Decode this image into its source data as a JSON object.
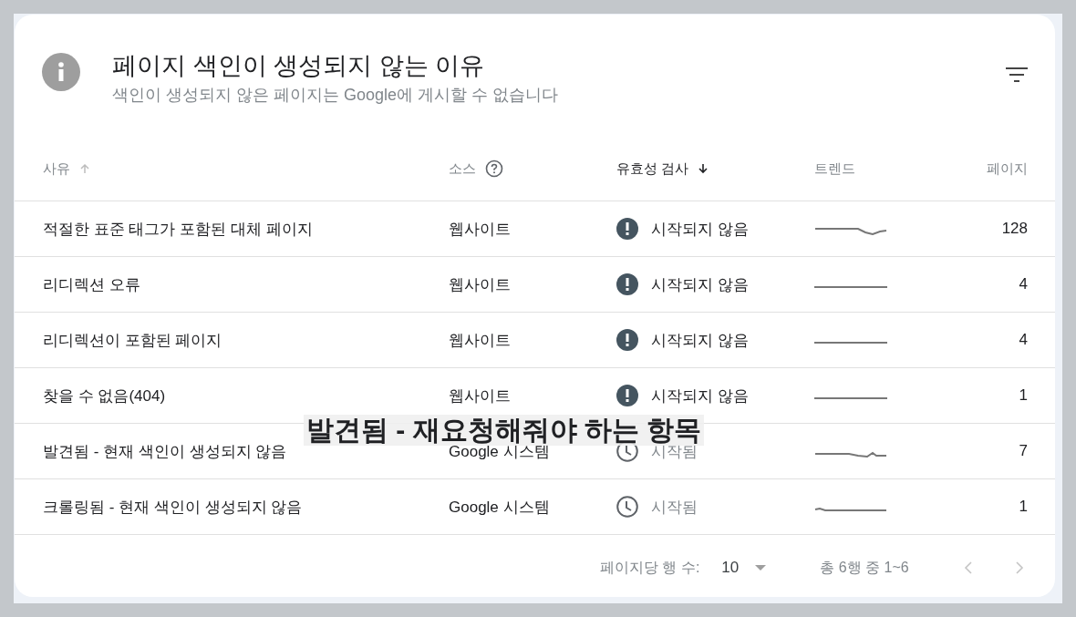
{
  "header": {
    "title": "페이지 색인이 생성되지 않는 이유",
    "subtitle": "색인이 생성되지 않은 페이지는 Google에 게시할 수 없습니다"
  },
  "table": {
    "columns": [
      {
        "label": "사유",
        "sort_up": true,
        "sort_down": false,
        "selected": false,
        "help": false
      },
      {
        "label": "소스",
        "sort_up": false,
        "sort_down": false,
        "selected": false,
        "help": true
      },
      {
        "label": "유효성 검사",
        "sort_up": false,
        "sort_down": true,
        "selected": true,
        "help": false
      },
      {
        "label": "트렌드",
        "sort_up": false,
        "sort_down": false,
        "selected": false,
        "help": false
      },
      {
        "label": "페이지",
        "sort_up": false,
        "sort_down": false,
        "selected": false,
        "help": false
      }
    ],
    "rows": [
      {
        "reason": "적절한 표준 태그가 포함된 대체 페이지",
        "source": "웹사이트",
        "status": "시작되지 않음",
        "kind": "not_started",
        "pages": "128"
      },
      {
        "reason": "리디렉션 오류",
        "source": "웹사이트",
        "status": "시작되지 않음",
        "kind": "not_started",
        "pages": "4"
      },
      {
        "reason": "리디렉션이 포함된 페이지",
        "source": "웹사이트",
        "status": "시작되지 않음",
        "kind": "not_started",
        "pages": "4"
      },
      {
        "reason": "찾을 수 없음(404)",
        "source": "웹사이트",
        "status": "시작되지 않음",
        "kind": "not_started",
        "pages": "1"
      },
      {
        "reason": "발견됨 - 현재 색인이 생성되지 않음",
        "source": "Google 시스템",
        "status": "시작됨",
        "kind": "started",
        "pages": "7"
      },
      {
        "reason": "크롤링됨 - 현재 색인이 생성되지 않음",
        "source": "Google 시스템",
        "status": "시작됨",
        "kind": "started",
        "pages": "1"
      }
    ]
  },
  "pagination": {
    "rows_per_page_label": "페이지당 행 수:",
    "rows_per_page": "10",
    "range": "총 6행 중 1~6"
  },
  "overlay_caption": "발견됨 - 재요청해줘야 하는 항목"
}
